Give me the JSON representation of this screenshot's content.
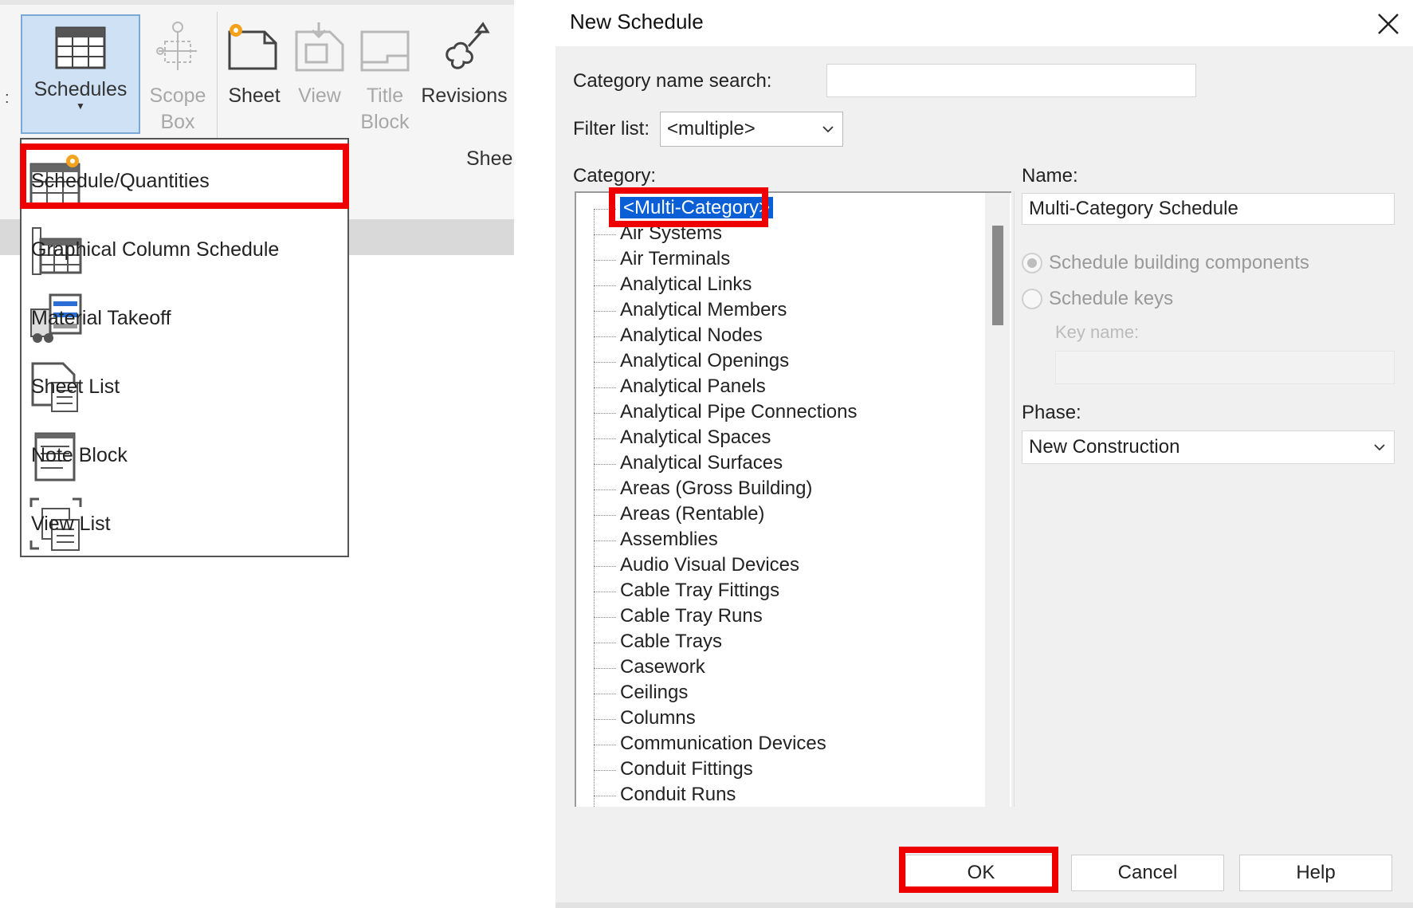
{
  "ribbon": {
    "buttons": {
      "schedules": "Schedules",
      "scope_box_line1": "Scope",
      "scope_box_line2": "Box",
      "sheet": "Sheet",
      "view": "View",
      "title_block_line1": "Title",
      "title_block_line2": "Block",
      "revisions": "Revisions"
    },
    "group_label": "Shee"
  },
  "schedules_menu": {
    "items": [
      {
        "label": "Schedule/Quantities",
        "icon": "schedule-quantities-icon",
        "highlighted": true
      },
      {
        "label": "Graphical Column Schedule",
        "icon": "graphical-column-schedule-icon"
      },
      {
        "label": "Material Takeoff",
        "icon": "material-takeoff-icon"
      },
      {
        "label": "Sheet List",
        "icon": "sheet-list-icon"
      },
      {
        "label": "Note Block",
        "icon": "note-block-icon"
      },
      {
        "label": "View List",
        "icon": "view-list-icon"
      }
    ]
  },
  "dialog": {
    "title": "New Schedule",
    "category_search_label": "Category name search:",
    "category_search_value": "",
    "filter_label": "Filter list:",
    "filter_value": "<multiple>",
    "category_label": "Category:",
    "categories": [
      "<Multi-Category>",
      "Air Systems",
      "Air Terminals",
      "Analytical Links",
      "Analytical Members",
      "Analytical Nodes",
      "Analytical Openings",
      "Analytical Panels",
      "Analytical Pipe Connections",
      "Analytical Spaces",
      "Analytical Surfaces",
      "Areas (Gross Building)",
      "Areas (Rentable)",
      "Assemblies",
      "Audio Visual Devices",
      "Cable Tray Fittings",
      "Cable Tray Runs",
      "Cable Trays",
      "Casework",
      "Ceilings",
      "Columns",
      "Communication Devices",
      "Conduit Fittings",
      "Conduit Runs"
    ],
    "selected_category": "<Multi-Category>",
    "name_label": "Name:",
    "name_value": "Multi-Category Schedule",
    "radio_building_components": "Schedule building components",
    "radio_keys": "Schedule keys",
    "key_name_label": "Key name:",
    "key_name_value": "",
    "phase_label": "Phase:",
    "phase_value": "New Construction",
    "ok_label": "OK",
    "cancel_label": "Cancel",
    "help_label": "Help"
  },
  "colors": {
    "highlight_red": "#ee0000",
    "selection_blue": "#0a5fd6",
    "ribbon_active": "#cfe2f5"
  }
}
